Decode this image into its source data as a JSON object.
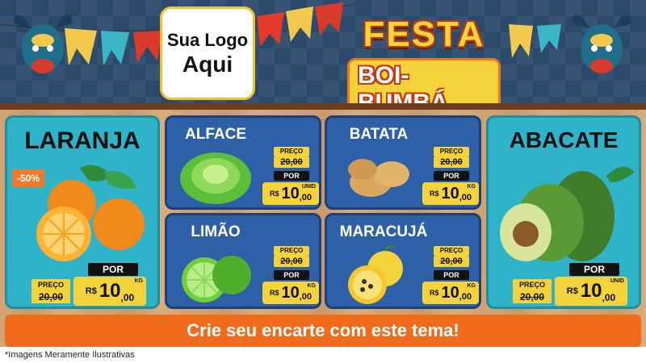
{
  "header": {
    "logo_line1": "Sua Logo",
    "logo_line2": "Aqui",
    "title_top": "FESTA",
    "title_bottom": "BOI-BUMBÁ"
  },
  "products": {
    "laranja": {
      "name": "LARANJA",
      "discount": "-50%",
      "old_label": "PREÇO",
      "old_price": "20,00",
      "new_label": "POR",
      "currency": "R$",
      "price_int": "10",
      "price_dec": ",00",
      "unit": "KG"
    },
    "alface": {
      "name": "ALFACE",
      "old_label": "PREÇO",
      "old_price": "20,00",
      "new_label": "POR",
      "currency": "R$",
      "price_int": "10",
      "price_dec": ",00",
      "unit": "UNID"
    },
    "batata": {
      "name": "BATATA",
      "old_label": "PREÇO",
      "old_price": "20,00",
      "new_label": "POR",
      "currency": "R$",
      "price_int": "10",
      "price_dec": ",00",
      "unit": "KG"
    },
    "limao": {
      "name": "LIMÃO",
      "old_label": "PREÇO",
      "old_price": "20,00",
      "new_label": "POR",
      "currency": "R$",
      "price_int": "10",
      "price_dec": ",00",
      "unit": "KG"
    },
    "maracuja": {
      "name": "MARACUJÁ",
      "old_label": "PREÇO",
      "old_price": "20,00",
      "new_label": "POR",
      "currency": "R$",
      "price_int": "10",
      "price_dec": ",00",
      "unit": "KG"
    },
    "abacate": {
      "name": "ABACATE",
      "old_label": "PREÇO",
      "old_price": "20,00",
      "new_label": "POR",
      "currency": "R$",
      "price_int": "10",
      "price_dec": ",00",
      "unit": "UNID"
    }
  },
  "cta": "Crie seu encarte com este tema!",
  "footnote": "*Imagens Meramente Ilustrativas",
  "icons": [
    "bull-head-icon",
    "orange-icon",
    "lettuce-icon",
    "potato-icon",
    "lime-icon",
    "passion-fruit-icon",
    "avocado-icon",
    "festival-flag-icon"
  ],
  "colors": {
    "header_bg": "#2b4a6b",
    "blue_panel": "#2e60a8",
    "teal_panel": "#2fb3c9",
    "price_yellow": "#f4d23a",
    "cta_orange": "#f16b1d",
    "discount_orange": "#f07a2a"
  }
}
